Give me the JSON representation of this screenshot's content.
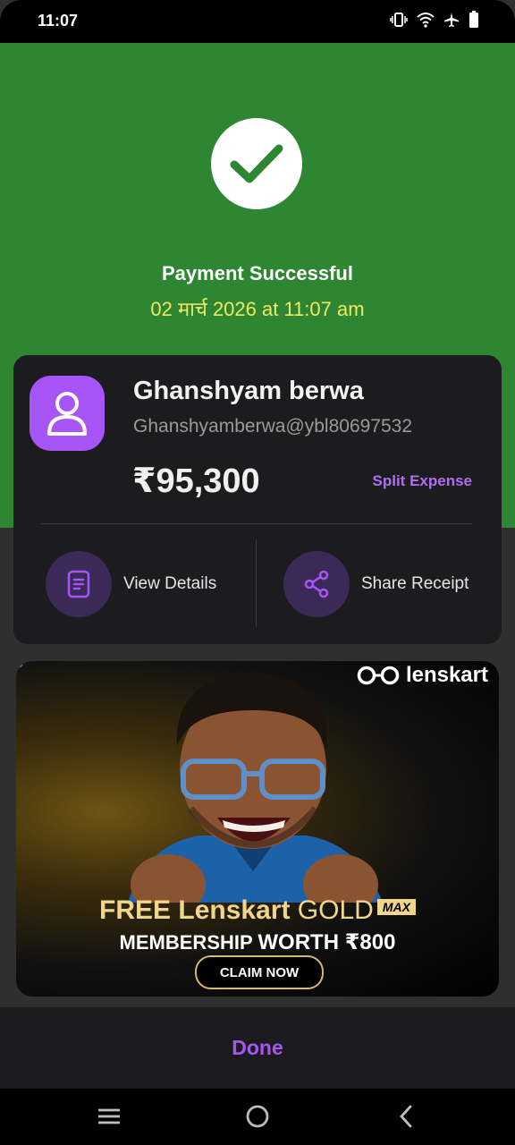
{
  "status_bar": {
    "time": "11:07",
    "icons": [
      "vibrate-icon",
      "wifi-icon",
      "airplane-icon",
      "battery-icon"
    ]
  },
  "payment": {
    "title": "Payment Successful",
    "datetime": "02 मार्च 2026 at 11:07 am"
  },
  "payee": {
    "name": "Ghanshyam berwa",
    "upi_id": "Ghanshyamberwa@ybl80697532",
    "amount": "₹95,300",
    "split_label": "Split Expense"
  },
  "actions": [
    {
      "label": "View Details",
      "icon": "document-icon"
    },
    {
      "label": "Share Receipt",
      "icon": "share-icon"
    }
  ],
  "banner": {
    "brand": "lenskart",
    "line1_prefix": "FREE Lenskart ",
    "line1_gold": "GOLD",
    "badge": "MAX",
    "line2_prefix": "MEMBERSHIP ",
    "line2_emphasis": "WORTH ₹800",
    "cta": "CLAIM NOW"
  },
  "footer": {
    "done_label": "Done"
  },
  "navigation": [
    "menu-icon",
    "home-icon",
    "back-icon"
  ],
  "colors": {
    "success_green": "#2e8532",
    "date_yellow": "#f0ea63",
    "accent_purple": "#a855f7",
    "card_bg": "#1c1c1e"
  }
}
